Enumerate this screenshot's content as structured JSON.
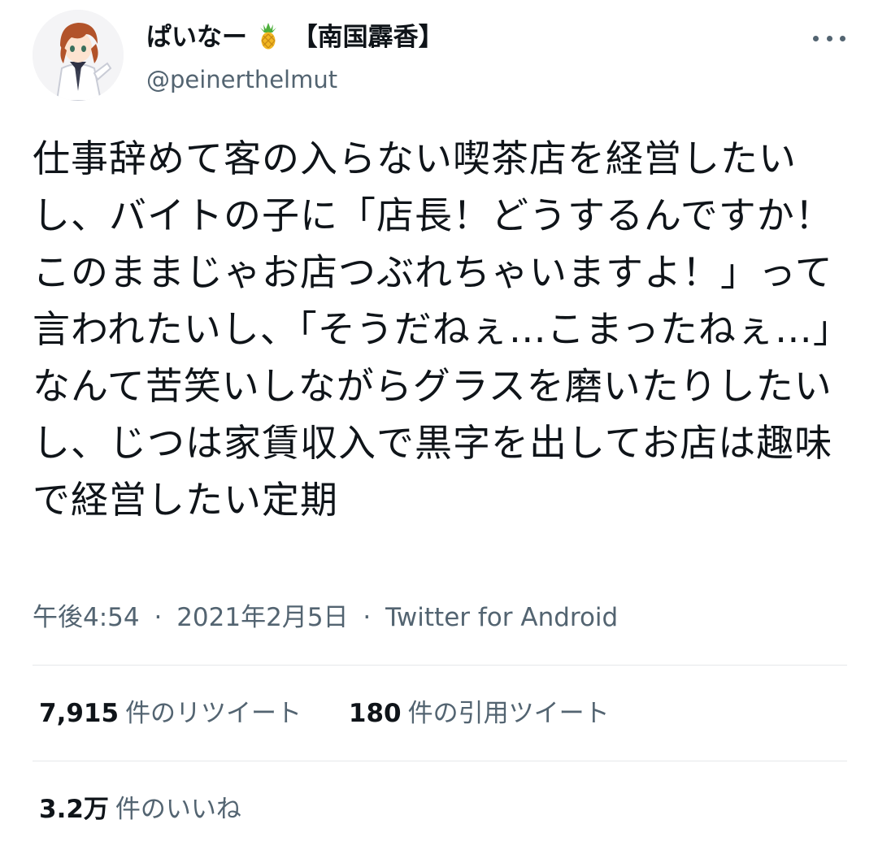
{
  "author": {
    "display_name": "ぱいなー",
    "display_name_emoji": "pineapple-icon",
    "display_name_suffix": "【南国霹香】",
    "handle": "@peinerthelmut"
  },
  "menu": {
    "icon": "more-horizontal-icon"
  },
  "tweet": {
    "text": "仕事辞めて客の入らない喫茶店を経営したいし、バイトの子に「店長！どうするんですか！このままじゃお店つぶれちゃいますよ！」って言われたいし、「そうだねぇ…こまったねぇ…」なんて苦笑いしながらグラスを磨いたりしたいし、じつは家賃収入で黒字を出してお店は趣味で経営したい定期",
    "time": "午後4:54",
    "date": "2021年2月5日",
    "separator": "·",
    "source": "Twitter for Android"
  },
  "stats": {
    "retweets": {
      "count": "7,915",
      "label": "件のリツイート"
    },
    "quotes": {
      "count": "180",
      "label": "件の引用ツイート"
    },
    "likes": {
      "count": "3.2万",
      "label": "件のいいね"
    }
  },
  "colors": {
    "text_primary": "#0f1419",
    "text_secondary": "#536471",
    "divider": "#e6e8ea"
  }
}
